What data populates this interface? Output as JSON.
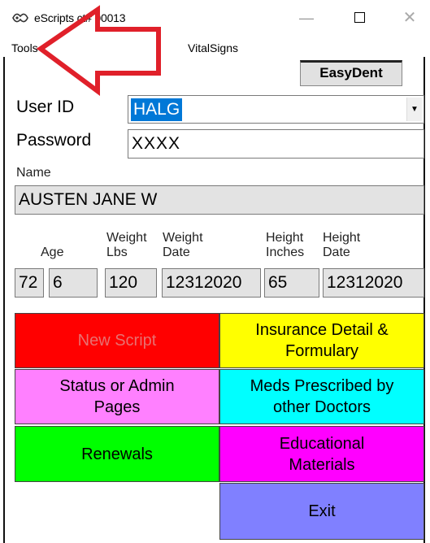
{
  "window": {
    "title": "eScripts      ct# 00013",
    "minimize": "—",
    "close": "✕"
  },
  "menu": {
    "tools": "Tools",
    "vitalsigns": "VitalSigns"
  },
  "easydent_label": "EasyDent",
  "login": {
    "userid_label": "User ID",
    "userid_value": "HALG",
    "password_label": "Password",
    "password_value": "XXXX"
  },
  "patient": {
    "name_label": "Name",
    "name_value": "AUSTEN JANE W",
    "age_label": "Age",
    "weight_lbs_label1": "Weight",
    "weight_lbs_label2": "Lbs",
    "weight_date_label1": "Weight",
    "weight_date_label2": "Date",
    "height_in_label1": "Height",
    "height_in_label2": "Inches",
    "height_date_label1": "Height",
    "height_date_label2": "Date",
    "age_years": "72",
    "age_months": "6",
    "weight_lbs": "120",
    "weight_date": "12312020",
    "height_inches": "65",
    "height_date": "12312020"
  },
  "buttons": {
    "new_script": "New Script",
    "insurance_line1": "Insurance Detail &",
    "insurance_line2": "Formulary",
    "status_line1": "Status or Admin",
    "status_line2": "Pages",
    "meds_line1": "Meds Prescribed by",
    "meds_line2": "other Doctors",
    "renewals": "Renewals",
    "educational_line1": "Educational",
    "educational_line2": "Materials",
    "exit": "Exit"
  },
  "colors": {
    "new_script_bg": "#ff0000",
    "insurance_bg": "#ffff00",
    "status_bg": "#ff80ff",
    "meds_bg": "#00ffff",
    "renewals_bg": "#00ff00",
    "educational_bg": "#ff00ff",
    "exit_bg": "#8080ff",
    "annotation_arrow": "#e0202a"
  },
  "annotation": {
    "type": "red outline arrow pointing to Tools menu"
  }
}
